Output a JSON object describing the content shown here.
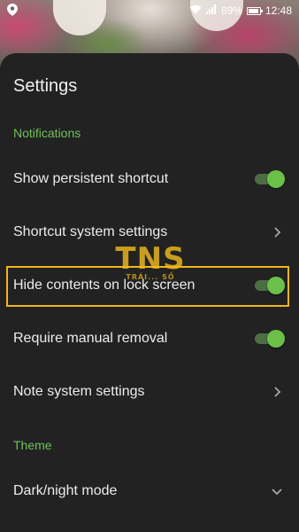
{
  "status_bar": {
    "battery_percent": "89%",
    "battery_level": 0.89,
    "time": "12:48",
    "icons": [
      "location-icon",
      "wifi-icon",
      "signal-icon",
      "battery-icon"
    ]
  },
  "sheet": {
    "title": "Settings",
    "sections": [
      {
        "header": "Notifications",
        "rows": [
          {
            "label": "Show persistent shortcut",
            "control": "toggle",
            "on": true
          },
          {
            "label": "Shortcut system settings",
            "control": "chevron-right"
          },
          {
            "label": "Hide contents on lock screen",
            "control": "toggle",
            "on": true
          },
          {
            "label": "Require manual removal",
            "control": "toggle",
            "on": true
          },
          {
            "label": "Note system settings",
            "control": "chevron-right"
          }
        ]
      },
      {
        "header": "Theme",
        "rows": [
          {
            "label": "Dark/night mode",
            "control": "chevron-down"
          }
        ]
      }
    ]
  },
  "watermark": {
    "main": "TNS",
    "sub": "TRÁI... SỐ"
  },
  "colors": {
    "accent_green": "#6cc04a",
    "highlight": "#f3b51a",
    "sheet_bg": "#222222"
  }
}
